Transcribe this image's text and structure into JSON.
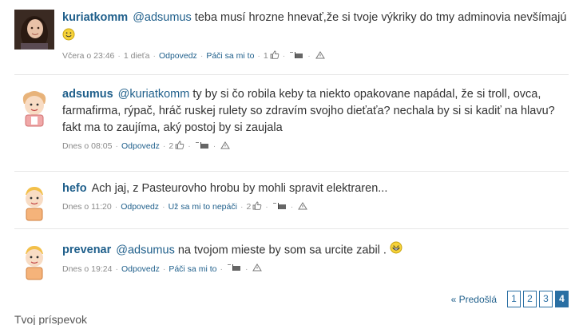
{
  "comments": [
    {
      "author": "kuriatkomm",
      "mention": "@adsumus",
      "text": " teba musí hrozne hnevať,že si tvoje výkriky do tmy adminovia nevšímajú",
      "emoji": "smile",
      "time": "Včera o 23:46",
      "children": "1 dieťa",
      "reply": "Odpovedz",
      "like": "Páči sa mi to",
      "likes": "1"
    },
    {
      "author": "adsumus",
      "mention": "@kuriatkomm",
      "text": " ty by si čo robila keby ta niekto opakovane napádal, že si troll, ovca, farmafirma, rýpač, hráč ruskej rulety so zdravím svojho dieťaťa? nechala by si si kadiť na hlavu? fakt ma to zaujíma, aký postoj by si zaujala",
      "time": "Dnes o 08:05",
      "reply": "Odpovedz",
      "likes": "2"
    },
    {
      "author": "hefo",
      "text": "Ach jaj, z Pasteurovho hrobu by mohli spravit elektraren...",
      "time": "Dnes o 11:20",
      "reply": "Odpovedz",
      "like": "Už sa mi to nepáči",
      "likes": "2"
    },
    {
      "author": "prevenar",
      "mention": "@adsumus",
      "text": " na tvojom mieste by som sa urcite zabil .",
      "emoji": "laugh",
      "time": "Dnes o 19:24",
      "reply": "Odpovedz",
      "like": "Páči sa mi to"
    }
  ],
  "pager": {
    "prev": "« Predošlá",
    "pages": [
      "1",
      "2",
      "3",
      "4"
    ],
    "active": "4"
  },
  "section_title": "Tvoj príspevok",
  "colors": {
    "link": "#1f5f8b",
    "accent": "#2a6fa3",
    "divider": "#e6e6e6"
  }
}
